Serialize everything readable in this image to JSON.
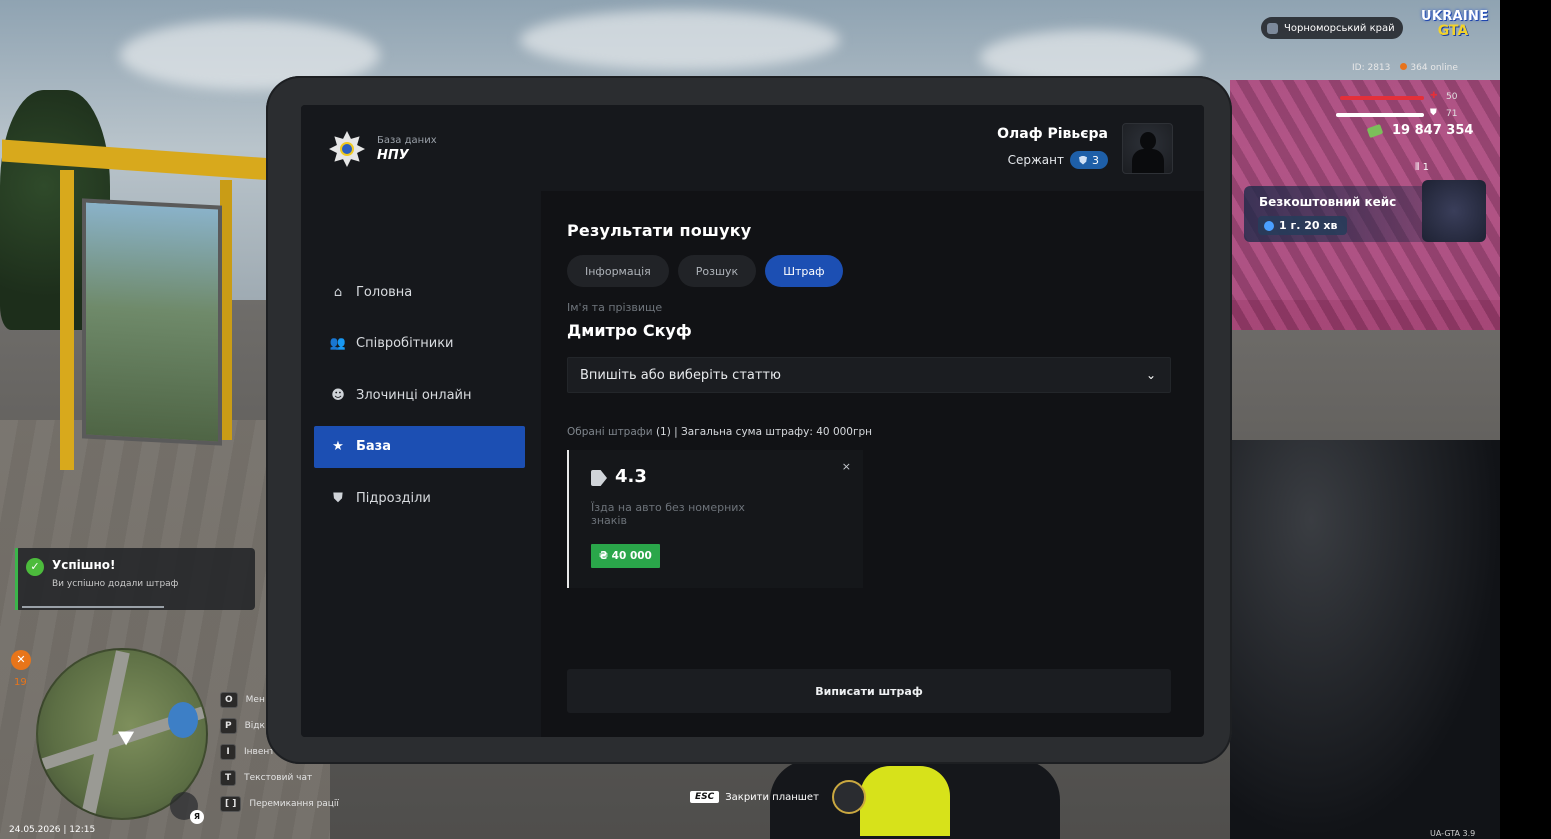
{
  "hud": {
    "server_name": "Чорноморський край",
    "logo_line1": "UKRAINE",
    "logo_line2": "GTA",
    "player_id": "ID: 2813",
    "online": "364 online",
    "health": "50",
    "armor": "71",
    "money": "19 847 354",
    "ammo": "1",
    "free_case_title": "Безкоштовний кейс",
    "free_case_timer": "1 г. 20 хв",
    "hunger": "19",
    "datetime": "24.05.2026 | 12:15",
    "version": "UA-GTA 3.9",
    "close_hint_key": "ESC",
    "close_hint_label": "Закрити планшет",
    "voice_key": "Я"
  },
  "keybinds": [
    {
      "key": "O",
      "label": "Мен"
    },
    {
      "key": "P",
      "label": "Відк"
    },
    {
      "key": "I",
      "label": "Інвент"
    },
    {
      "key": "T",
      "label": "Текстовий чат"
    },
    {
      "key": "[ ]",
      "label": "Перемикання рації"
    }
  ],
  "toast": {
    "title": "Успішно!",
    "message": "Ви успішно додали штраф",
    "progress": 0.63
  },
  "tablet": {
    "brand_small": "База даних",
    "brand_big": "НПУ",
    "nav": [
      {
        "label": "Головна",
        "icon": "home-icon"
      },
      {
        "label": "Співробітники",
        "icon": "people-icon"
      },
      {
        "label": "Злочинці онлайн",
        "icon": "mask-icon"
      },
      {
        "label": "База",
        "icon": "star-icon",
        "active": true
      },
      {
        "label": "Підрозділи",
        "icon": "shield-icon"
      }
    ],
    "user": {
      "name": "Олаф Рівьєра",
      "rank": "Сержант",
      "rank_level": "3"
    },
    "content": {
      "title": "Результати пошуку",
      "tabs": [
        {
          "label": "Інформація"
        },
        {
          "label": "Розшук"
        },
        {
          "label": "Штраф",
          "active": true
        }
      ],
      "name_label": "Ім'я та прізвище",
      "name_value": "Дмитро Скуф",
      "article_placeholder": "Впишіть або виберіть статтю",
      "selected_prefix": "Обрані штрафи",
      "selected_count": "(1) | Загальна сума штрафу: 40 000грн",
      "fine": {
        "code": "4.3",
        "description": "Їзда на авто без номерних знаків",
        "amount": "₴ 40 000",
        "close_symbol": "×"
      },
      "issue_button": "Виписати штраф"
    }
  },
  "colors": {
    "accent_blue": "#1c4fb3",
    "success_green": "#2aa64a",
    "health_red": "#e3303a"
  }
}
